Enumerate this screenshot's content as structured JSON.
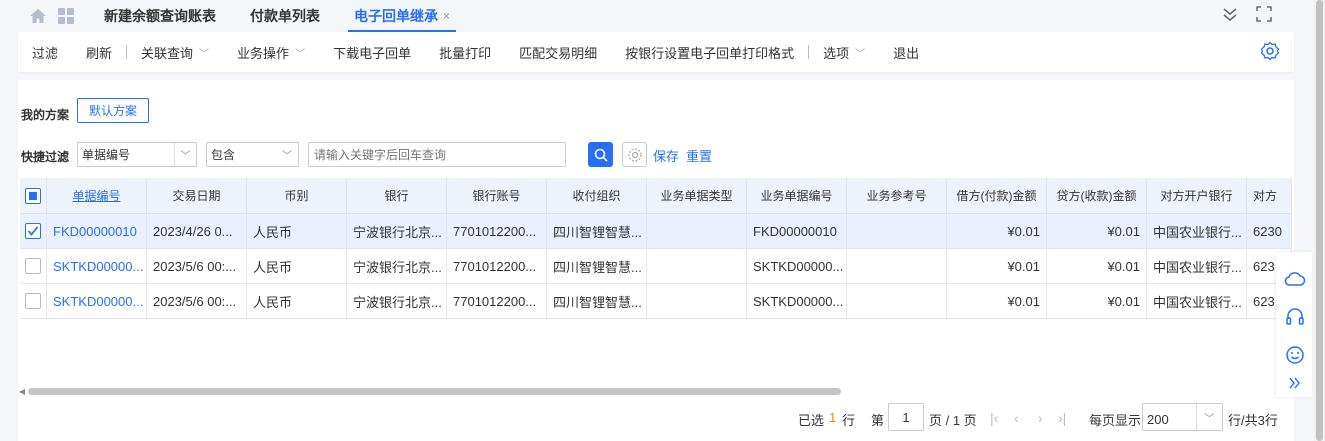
{
  "tabs": [
    {
      "label": "新建余额查询账表",
      "active": false
    },
    {
      "label": "付款单列表",
      "active": false
    },
    {
      "label": "电子回单继承",
      "active": true
    }
  ],
  "tab_close": "×",
  "toolbar": {
    "items": [
      "过滤",
      "刷新",
      "关联查询",
      "业务操作",
      "下载电子回单",
      "批量打印",
      "匹配交易明细",
      "按银行设置电子回单打印格式",
      "选项",
      "退出"
    ]
  },
  "scheme": {
    "label": "我的方案",
    "default_button": "默认方案"
  },
  "quick_filter": {
    "label": "快捷过滤",
    "field_value": "单据编号",
    "operator_value": "包含",
    "search_placeholder": "请输入关键字后回车查询",
    "save_label": "保存",
    "reset_label": "重置"
  },
  "table": {
    "columns": [
      "单据编号",
      "交易日期",
      "币别",
      "银行",
      "银行账号",
      "收付组织",
      "业务单据类型",
      "业务单据编号",
      "业务参考号",
      "借方(付款)金额",
      "贷方(收款)金额",
      "对方开户银行",
      "对方"
    ],
    "rows": [
      {
        "selected": true,
        "cells": [
          "FKD00000010",
          "2023/4/26 0...",
          "人民币",
          "宁波银行北京...",
          "7701012200...",
          "四川智锂智慧...",
          "",
          "FKD00000010",
          "",
          "¥0.01",
          "¥0.01",
          "中国农业银行...",
          "6230"
        ]
      },
      {
        "selected": false,
        "cells": [
          "SKTKD00000...",
          "2023/5/6 00:...",
          "人民币",
          "宁波银行北京...",
          "7701012200...",
          "四川智锂智慧...",
          "",
          "SKTKD00000...",
          "",
          "¥0.01",
          "¥0.01",
          "中国农业银行...",
          "623"
        ]
      },
      {
        "selected": false,
        "cells": [
          "SKTKD00000...",
          "2023/5/6 00:...",
          "人民币",
          "宁波银行北京...",
          "7701012200...",
          "四川智锂智慧...",
          "",
          "SKTKD00000...",
          "",
          "¥0.01",
          "¥0.01",
          "中国农业银行...",
          "623"
        ]
      }
    ]
  },
  "pager": {
    "selected_prefix": "已选",
    "selected_count": "1",
    "selected_suffix": "行",
    "page_prefix": "第",
    "page_value": "1",
    "page_suffix": "页 / 1 页",
    "size_prefix": "每页显示",
    "size_value": "200",
    "size_suffix": "行/共3行"
  },
  "colors": {
    "accent": "#276ff5",
    "count": "#f08c00"
  }
}
